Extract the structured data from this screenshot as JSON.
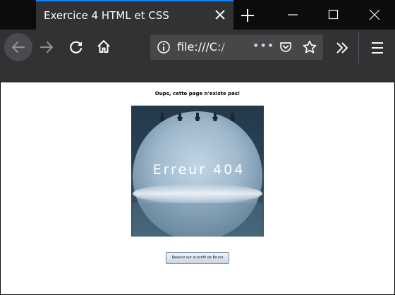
{
  "browser": {
    "tab_title": "Exercice 4 HTML et CSS",
    "url_text": "file:///C:/",
    "url_dots": "•••"
  },
  "page": {
    "heading": "Oups, cette page n'existe pas!",
    "image_text": "Erreur 404",
    "button_label": "Revenir sur le profil de Bruno"
  },
  "colors": {
    "tab_accent": "#0a84ff",
    "toolbar_bg": "#323234",
    "tabstrip_bg": "#0c0c0d",
    "urlbar_bg": "#474749"
  },
  "icons": {
    "close_tab": "close-icon",
    "new_tab": "plus-icon",
    "minimize": "minimize-icon",
    "maximize": "maximize-icon",
    "close_window": "close-icon",
    "back": "arrow-left-icon",
    "forward": "arrow-right-icon",
    "reload": "reload-icon",
    "home": "home-icon",
    "info": "info-icon",
    "pocket": "pocket-icon",
    "bookmark": "star-icon",
    "overflow": "chevron-double-right-icon",
    "menu": "hamburger-icon"
  }
}
